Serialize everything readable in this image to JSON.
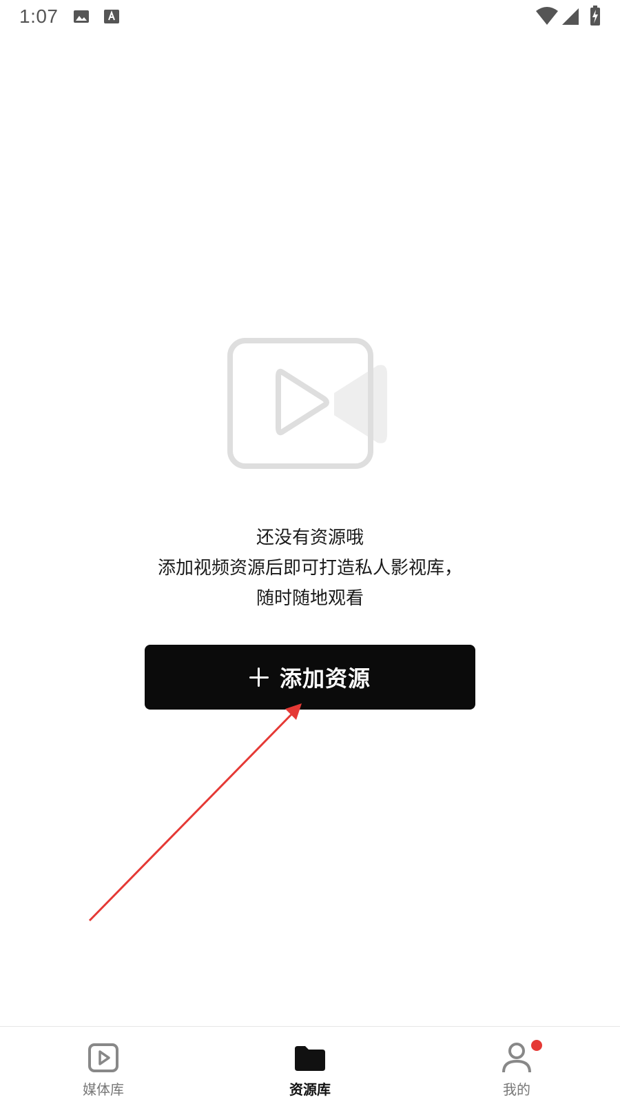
{
  "status_bar": {
    "time": "1:07",
    "icons": [
      "image-icon",
      "text-a-icon",
      "wifi-icon",
      "signal-icon",
      "battery-charging-icon"
    ]
  },
  "empty_state": {
    "icon": "video-camera-icon",
    "line1": "还没有资源哦",
    "line2": "添加视频资源后即可打造私人影视库，",
    "line3": "随时随地观看"
  },
  "add_button": {
    "icon": "plus-icon",
    "label": "添加资源"
  },
  "bottom_nav": {
    "items": [
      {
        "label": "媒体库",
        "icon": "play-box-icon",
        "active": false
      },
      {
        "label": "资源库",
        "icon": "folder-icon",
        "active": true
      },
      {
        "label": "我的",
        "icon": "person-icon",
        "active": false,
        "badge": true
      }
    ]
  },
  "colors": {
    "accent_black": "#0b0b0b",
    "annotation_red": "#e53935",
    "badge_red": "#e53935",
    "illustration_gray": "#dddddd"
  }
}
